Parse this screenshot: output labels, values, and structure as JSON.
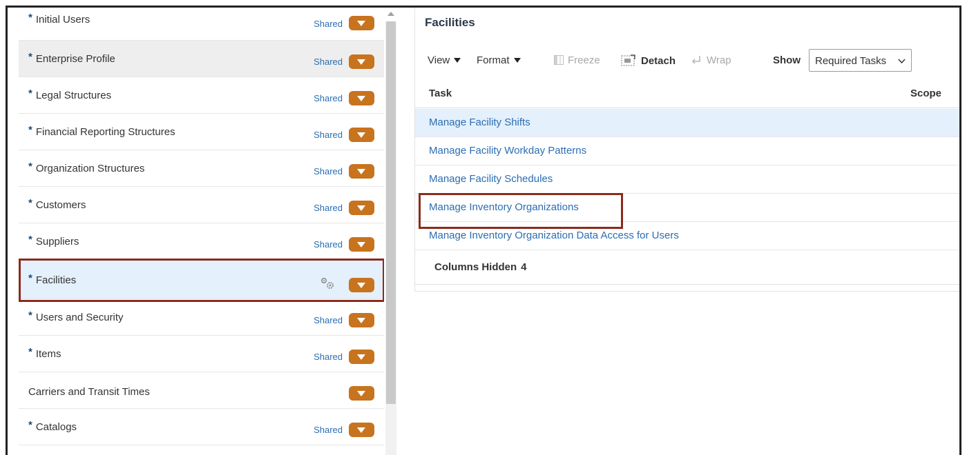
{
  "setup_list": {
    "items": [
      {
        "label": "Initial Users",
        "required": true,
        "badge": "Shared",
        "icon": "dropdown-button"
      },
      {
        "label": "Enterprise Profile",
        "required": true,
        "badge": "Shared",
        "icon": "dropdown-button"
      },
      {
        "label": "Legal Structures",
        "required": true,
        "badge": "Shared",
        "icon": "dropdown-button"
      },
      {
        "label": "Financial Reporting Structures",
        "required": true,
        "badge": "Shared",
        "icon": "dropdown-button"
      },
      {
        "label": "Organization Structures",
        "required": true,
        "badge": "Shared",
        "icon": "dropdown-button"
      },
      {
        "label": "Customers",
        "required": true,
        "badge": "Shared",
        "icon": "dropdown-button"
      },
      {
        "label": "Suppliers",
        "required": true,
        "badge": "Shared",
        "icon": "dropdown-button"
      },
      {
        "label": "Facilities",
        "required": true,
        "badge": "",
        "icon": "gears-icon",
        "selected": true
      },
      {
        "label": "Users and Security",
        "required": true,
        "badge": "Shared",
        "icon": "dropdown-button"
      },
      {
        "label": "Items",
        "required": true,
        "badge": "Shared",
        "icon": "dropdown-button"
      },
      {
        "label": "Carriers and Transit Times",
        "required": false,
        "badge": "",
        "icon": "dropdown-button"
      },
      {
        "label": "Catalogs",
        "required": true,
        "badge": "Shared",
        "icon": "dropdown-button"
      }
    ],
    "required_marker": "*"
  },
  "detail_panel": {
    "title": "Facilities",
    "toolbar": {
      "view": "View",
      "format": "Format",
      "freeze": "Freeze",
      "detach": "Detach",
      "wrap": "Wrap",
      "show_label": "Show",
      "show_value": "Required Tasks"
    },
    "columns": {
      "task": "Task",
      "scope": "Scope"
    },
    "tasks": [
      "Manage Facility Shifts",
      "Manage Facility Workday Patterns",
      "Manage Facility Schedules",
      "Manage Inventory Organizations",
      "Manage Inventory Organization Data Access for Users"
    ],
    "columns_hidden_label": "Columns Hidden",
    "columns_hidden_count": "4"
  },
  "colors": {
    "accent_orange": "#c8731e",
    "link_blue": "#2b6db2",
    "highlight_red": "#8b2a1c",
    "selection_blue": "#e4f0fb"
  }
}
